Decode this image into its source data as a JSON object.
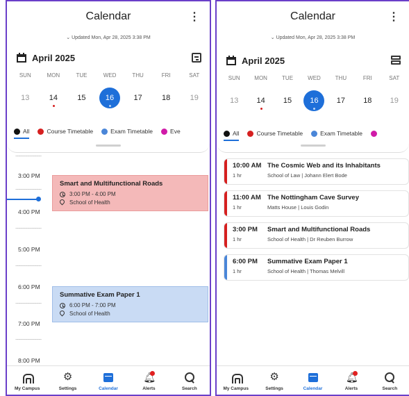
{
  "colors": {
    "accent": "#1e6fd9",
    "course": "#d62020",
    "exam": "#4a86d8",
    "other": "#d01aa8",
    "frame": "#6a3fc9"
  },
  "left": {
    "title": "Calendar",
    "more": "⋮",
    "updated": "Updated Mon, Apr 28, 2025 3:38 PM",
    "month": "April 2025",
    "days": [
      {
        "name": "SUN",
        "date": "13"
      },
      {
        "name": "MON",
        "date": "14"
      },
      {
        "name": "TUE",
        "date": "15"
      },
      {
        "name": "WED",
        "date": "16"
      },
      {
        "name": "THU",
        "date": "17"
      },
      {
        "name": "FRI",
        "date": "18"
      },
      {
        "name": "SAT",
        "date": "19"
      }
    ],
    "filters": [
      "All",
      "Course Timetable",
      "Exam Timetable",
      "Eve"
    ],
    "hours": [
      "3:00 PM",
      "4:00 PM",
      "5:00 PM",
      "6:00 PM",
      "7:00 PM",
      "8:00 PM"
    ],
    "events": [
      {
        "title": "Smart and Multifunctional Roads",
        "time": "3:00 PM - 4:00 PM",
        "location": "School of Health"
      },
      {
        "title": "Summative Exam Paper 1",
        "time": "6:00 PM - 7:00 PM",
        "location": "School of Health"
      }
    ]
  },
  "right": {
    "title": "Calendar",
    "more": "⋮",
    "updated": "Updated Mon, Apr 28, 2025 3:38 PM",
    "month": "April 2025",
    "days": [
      {
        "name": "SUN",
        "date": "13"
      },
      {
        "name": "MON",
        "date": "14"
      },
      {
        "name": "TUE",
        "date": "15"
      },
      {
        "name": "WED",
        "date": "16"
      },
      {
        "name": "THU",
        "date": "17"
      },
      {
        "name": "FRI",
        "date": "18"
      },
      {
        "name": "SAT",
        "date": "19"
      }
    ],
    "filters": [
      "All",
      "Course Timetable",
      "Exam Timetable"
    ],
    "events": [
      {
        "time": "10:00 AM",
        "title": "The Cosmic Web and its Inhabitants",
        "duration": "1 hr",
        "details": "School of Law | Johann Elert Bode",
        "color": "#d62020"
      },
      {
        "time": "11:00 AM",
        "title": "The Nottingham Cave Survey",
        "duration": "1 hr",
        "details": "Matts House | Louis Godin",
        "color": "#d62020"
      },
      {
        "time": "3:00 PM",
        "title": "Smart and Multifunctional Roads",
        "duration": "1 hr",
        "details": "School of Health | Dr Reuben Burrow",
        "color": "#d62020"
      },
      {
        "time": "6:00 PM",
        "title": "Summative Exam Paper 1",
        "duration": "1 hr",
        "details": "School of Health | Thomas Melvill",
        "color": "#4a86d8"
      }
    ]
  },
  "nav": [
    {
      "label": "My Campus",
      "icon": "home-icon"
    },
    {
      "label": "Settings",
      "icon": "gear-icon"
    },
    {
      "label": "Calendar",
      "icon": "calendar-icon"
    },
    {
      "label": "Alerts",
      "icon": "bell-icon"
    },
    {
      "label": "Search",
      "icon": "search-icon"
    }
  ]
}
